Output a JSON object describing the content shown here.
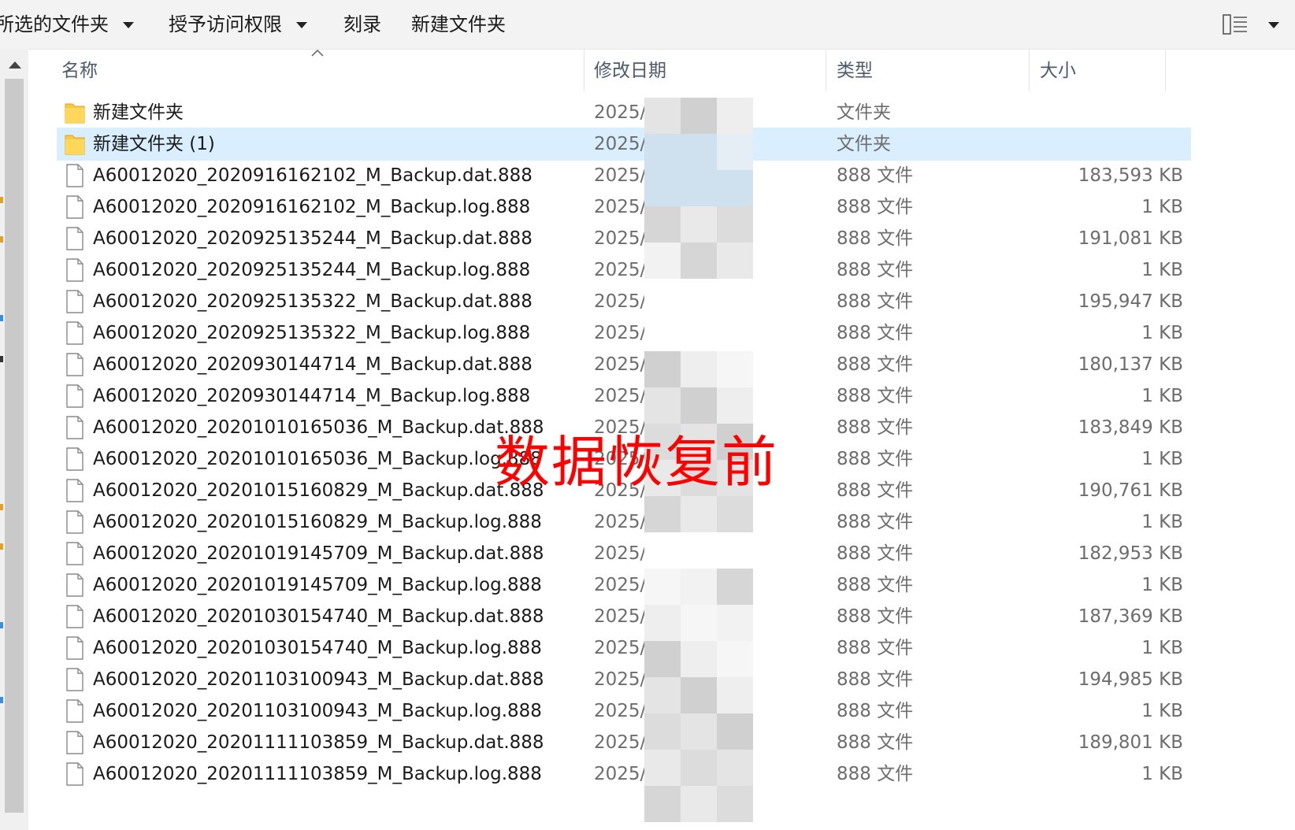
{
  "toolbar": {
    "selected_folders_label": "所选的文件夹",
    "grant_access_label": "授予访问权限",
    "burn_label": "刻录",
    "new_folder_label": "新建文件夹"
  },
  "columns": {
    "name": "名称",
    "date": "修改日期",
    "type": "类型",
    "size": "大小"
  },
  "overlay_text": "数据恢复前",
  "date_prefix": "2025/",
  "rows": [
    {
      "name": "新建文件夹",
      "type": "文件夹",
      "size": "",
      "kind": "folder",
      "selected": false
    },
    {
      "name": "新建文件夹 (1)",
      "type": "文件夹",
      "size": "",
      "kind": "folder",
      "selected": true
    },
    {
      "name": "A60012020_2020916162102_M_Backup.dat.888",
      "type": "888 文件",
      "size": "183,593 KB",
      "kind": "file",
      "selected": false
    },
    {
      "name": "A60012020_2020916162102_M_Backup.log.888",
      "type": "888 文件",
      "size": "1 KB",
      "kind": "file",
      "selected": false
    },
    {
      "name": "A60012020_2020925135244_M_Backup.dat.888",
      "type": "888 文件",
      "size": "191,081 KB",
      "kind": "file",
      "selected": false
    },
    {
      "name": "A60012020_2020925135244_M_Backup.log.888",
      "type": "888 文件",
      "size": "1 KB",
      "kind": "file",
      "selected": false
    },
    {
      "name": "A60012020_2020925135322_M_Backup.dat.888",
      "type": "888 文件",
      "size": "195,947 KB",
      "kind": "file",
      "selected": false
    },
    {
      "name": "A60012020_2020925135322_M_Backup.log.888",
      "type": "888 文件",
      "size": "1 KB",
      "kind": "file",
      "selected": false
    },
    {
      "name": "A60012020_2020930144714_M_Backup.dat.888",
      "type": "888 文件",
      "size": "180,137 KB",
      "kind": "file",
      "selected": false
    },
    {
      "name": "A60012020_2020930144714_M_Backup.log.888",
      "type": "888 文件",
      "size": "1 KB",
      "kind": "file",
      "selected": false
    },
    {
      "name": "A60012020_2020101016503 6_M_Backup.dat.888",
      "type": "888 文件",
      "size": "183,849 KB",
      "kind": "file",
      "selected": false
    },
    {
      "name": "A60012020_2020101016503 6_M_Backup.log.888",
      "type": "888 文件",
      "size": "1 KB",
      "kind": "file",
      "selected": false
    },
    {
      "name": "A60012020_2020101516082 9_M_Backup.dat.888",
      "type": "888 文件",
      "size": "190,761 KB",
      "kind": "file",
      "selected": false
    },
    {
      "name": "A60012020_2020101516082 9_M_Backup.log.888",
      "type": "888 文件",
      "size": "1 KB",
      "kind": "file",
      "selected": false
    },
    {
      "name": "A60012020_2020101914570 9_M_Backup.dat.888",
      "type": "888 文件",
      "size": "182,953 KB",
      "kind": "file",
      "selected": false
    },
    {
      "name": "A60012020_2020101914570 9_M_Backup.log.888",
      "type": "888 文件",
      "size": "1 KB",
      "kind": "file",
      "selected": false
    },
    {
      "name": "A60012020_2020103015474 0_M_Backup.dat.888",
      "type": "888 文件",
      "size": "187,369 KB",
      "kind": "file",
      "selected": false
    },
    {
      "name": "A60012020_2020103015474 0_M_Backup.log.888",
      "type": "888 文件",
      "size": "1 KB",
      "kind": "file",
      "selected": false
    },
    {
      "name": "A60012020_2020110310094 3_M_Backup.dat.888",
      "type": "888 文件",
      "size": "194,985 KB",
      "kind": "file",
      "selected": false
    },
    {
      "name": "A60012020_2020110310094 3_M_Backup.log.888",
      "type": "888 文件",
      "size": "1 KB",
      "kind": "file",
      "selected": false
    },
    {
      "name": "A60012020_2020111110385 9_M_Backup.dat.888",
      "type": "888 文件",
      "size": "189,801 KB",
      "kind": "file",
      "selected": false
    },
    {
      "name": "A60012020_2020111110385 9_M_Backup.log.888",
      "type": "888 文件",
      "size": "1 KB",
      "kind": "file",
      "selected": false
    }
  ]
}
